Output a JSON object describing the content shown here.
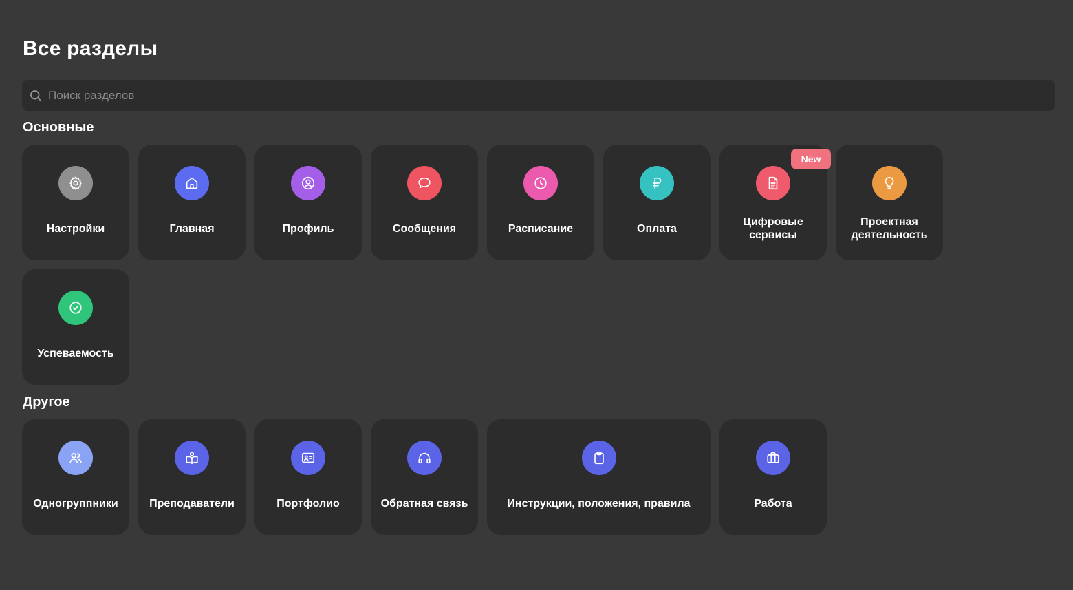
{
  "page": {
    "title": "Все разделы"
  },
  "search": {
    "placeholder": "Поиск разделов",
    "value": ""
  },
  "sections": {
    "main": {
      "title": "Основные",
      "items": [
        {
          "label": "Настройки",
          "icon": "gear-icon",
          "color": "#8f8f8f"
        },
        {
          "label": "Главная",
          "icon": "home-icon",
          "color": "#5b6cf0"
        },
        {
          "label": "Профиль",
          "icon": "user-circle-icon",
          "color": "#a45ee8"
        },
        {
          "label": "Сообщения",
          "icon": "chat-bubble-icon",
          "color": "#ee5561"
        },
        {
          "label": "Расписание",
          "icon": "clock-icon",
          "color": "#ec5aae"
        },
        {
          "label": "Оплата",
          "icon": "ruble-icon",
          "color": "#35c2c1"
        },
        {
          "label": "Цифровые сервисы",
          "icon": "document-icon",
          "color": "#ef5b6d",
          "badge": "New"
        },
        {
          "label": "Проектная деятельность",
          "icon": "lightbulb-icon",
          "color": "#eb9a42"
        },
        {
          "label": "Успеваемость",
          "icon": "check-circle-icon",
          "color": "#2fc67c"
        }
      ]
    },
    "other": {
      "title": "Другое",
      "items": [
        {
          "label": "Одногруппники",
          "icon": "users-icon",
          "color": "#8ba3f5"
        },
        {
          "label": "Преподаватели",
          "icon": "teacher-book-icon",
          "color": "#5b63e6"
        },
        {
          "label": "Портфолио",
          "icon": "id-card-icon",
          "color": "#5b63e6"
        },
        {
          "label": "Обратная связь",
          "icon": "headphones-icon",
          "color": "#5b63e6"
        },
        {
          "label": "Инструкции, положения, правила",
          "icon": "clipboard-icon",
          "color": "#5b63e6"
        },
        {
          "label": "Работа",
          "icon": "briefcase-icon",
          "color": "#5b63e6"
        }
      ]
    }
  }
}
